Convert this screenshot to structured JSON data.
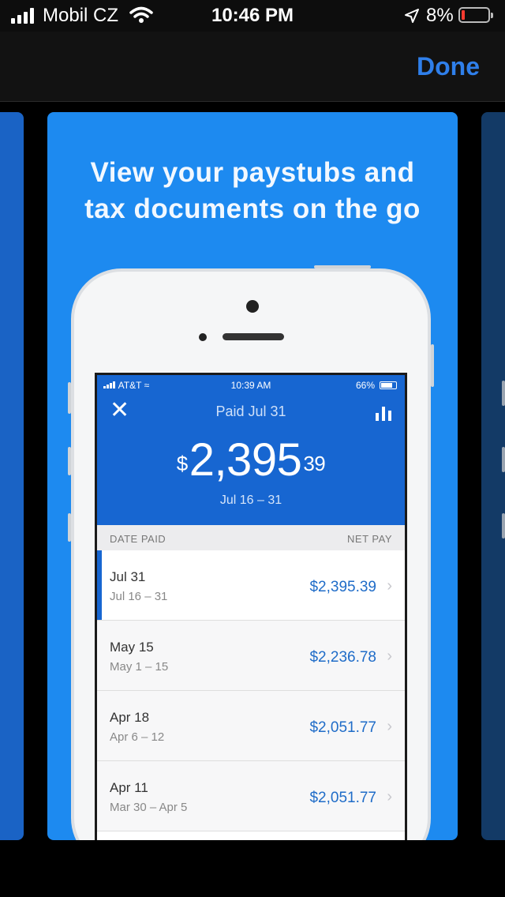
{
  "status_bar": {
    "carrier": "Mobil CZ",
    "time": "10:46 PM",
    "battery_percent": "8%",
    "battery_level": 0.08,
    "icons": [
      "signal-icon",
      "wifi-icon",
      "location-arrow-icon",
      "battery-icon"
    ]
  },
  "nav": {
    "done_label": "Done",
    "accent": "#2f7fea"
  },
  "card": {
    "headline_line1": "View your paystubs and",
    "headline_line2": "tax documents on the go",
    "background": "#1d8af0"
  },
  "mock_screen": {
    "status": {
      "carrier": "AT&T",
      "time": "10:39 AM",
      "battery": "66%"
    },
    "title": "Paid Jul 31",
    "amount": {
      "currency": "$",
      "whole": "2,395",
      "cents": "39"
    },
    "range": "Jul 16 – 31",
    "columns": {
      "left": "DATE PAID",
      "right": "NET PAY"
    },
    "rows": [
      {
        "date": "Jul 31",
        "period": "Jul 16 – 31",
        "amount": "$2,395.39"
      },
      {
        "date": "May 15",
        "period": "May 1 – 15",
        "amount": "$2,236.78"
      },
      {
        "date": "Apr 18",
        "period": "Apr 6 – 12",
        "amount": "$2,051.77"
      },
      {
        "date": "Apr 11",
        "period": "Mar 30 – Apr 5",
        "amount": "$2,051.77"
      }
    ],
    "header_color": "#1766d1"
  }
}
